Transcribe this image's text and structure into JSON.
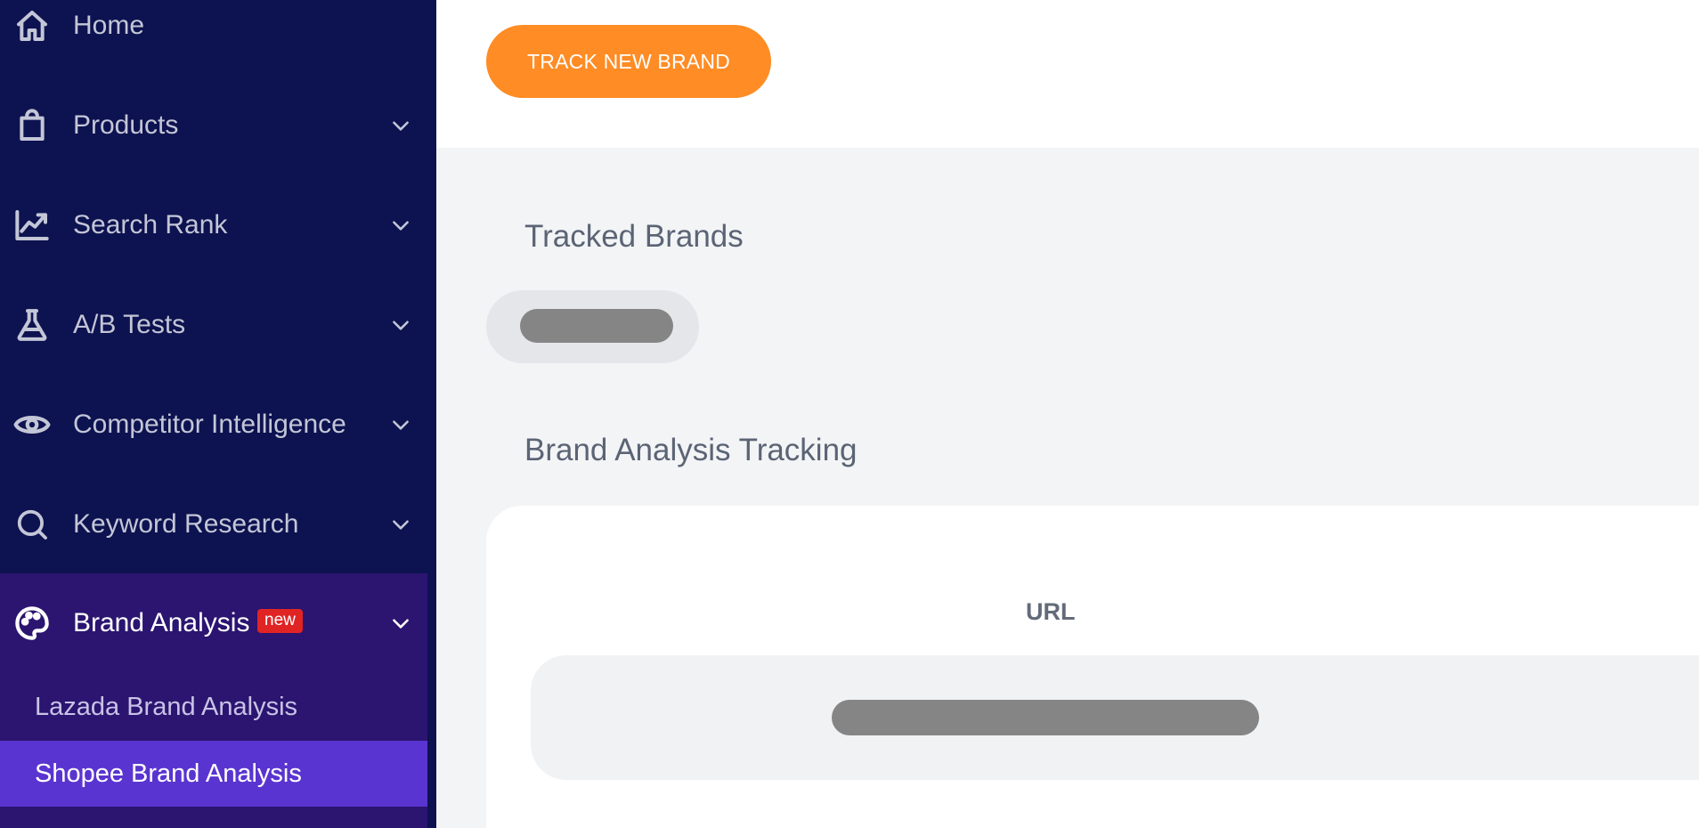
{
  "sidebar": {
    "items": [
      {
        "label": "Home",
        "icon": "home-icon"
      },
      {
        "label": "Products",
        "icon": "shopping-bag-icon"
      },
      {
        "label": "Search Rank",
        "icon": "trending-chart-icon"
      },
      {
        "label": "A/B Tests",
        "icon": "flask-icon"
      },
      {
        "label": "Competitor Intelligence",
        "icon": "eye-icon"
      },
      {
        "label": "Keyword Research",
        "icon": "search-icon"
      },
      {
        "label": "Brand Analysis",
        "icon": "palette-icon",
        "badge": "new"
      }
    ],
    "sub_items": [
      {
        "label": "Lazada Brand Analysis"
      },
      {
        "label": "Shopee Brand Analysis",
        "active": true
      }
    ]
  },
  "toolbar": {
    "track_button_label": "TRACK NEW BRAND"
  },
  "main": {
    "tracked_title": "Tracked Brands",
    "tracking_title": "Brand Analysis Tracking",
    "table": {
      "columns": [
        "URL"
      ]
    }
  },
  "colors": {
    "sidebar_bg": "#0d1250",
    "active_group_bg": "#2b1570",
    "active_item_bg": "#5a34d0",
    "accent": "#ff8c24",
    "badge": "#e02424"
  }
}
